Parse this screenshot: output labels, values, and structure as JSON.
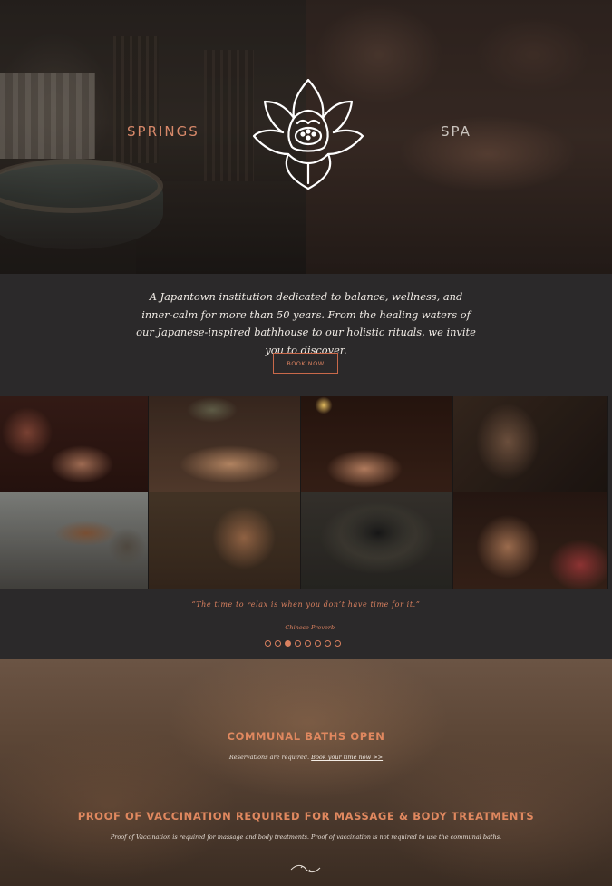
{
  "hero": {
    "left_label": "SPRINGS",
    "right_label": "SPA",
    "logo_icon": "lotus-icon"
  },
  "intro": {
    "text": "A Japantown institution dedicated to balance, wellness, and inner-calm for more than 50 years. From the healing waters of our Japanese-inspired bathhouse to our holistic rituals, we invite you to discover.",
    "book_button": "BOOK NOW"
  },
  "gallery": {
    "tiles": [
      "massage-room",
      "herbal-compress",
      "facial-massage",
      "steam-bath",
      "bath-lounge",
      "relaxation-bench",
      "flower-stone-basin",
      "back-treatment"
    ]
  },
  "quote": {
    "text": "“The time to relax is when you don’t have time for it.”",
    "author": "— Chinese Proverb",
    "slide_count": 8,
    "active_slide": 3
  },
  "notices": {
    "baths_title": "COMMUNAL BATHS OPEN",
    "baths_text": "Reservations are required.",
    "baths_link": "Book your time now >>",
    "vaccination_title": "PROOF OF VACCINATION REQUIRED FOR MASSAGE & BODY TREATMENTS",
    "vaccination_text": "Proof of Vaccination is required for massage and body treatments. Proof of vaccination is not required to use the communal baths."
  },
  "colors": {
    "accent": "#d9805f",
    "background": "#2b292a"
  }
}
